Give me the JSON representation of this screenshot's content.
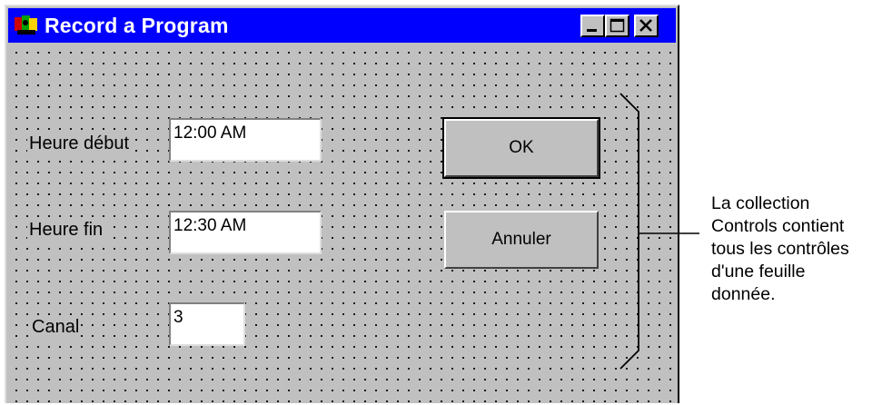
{
  "window": {
    "title": "Record a Program",
    "controls": {
      "minimize_icon": "minimize-icon",
      "maximize_icon": "maximize-icon",
      "close_icon": "close-icon"
    }
  },
  "form": {
    "fields": [
      {
        "label": "Heure début",
        "value": "12:00 AM"
      },
      {
        "label": "Heure fin",
        "value": "12:30 AM"
      },
      {
        "label": "Canal",
        "value": "3"
      }
    ],
    "buttons": {
      "ok": "OK",
      "cancel": "Annuler"
    }
  },
  "annotation": {
    "lines": [
      "La collection",
      "Controls contient",
      "tous les contrôles",
      "d'une feuille",
      "donnée."
    ]
  },
  "colors": {
    "titlebar": "#0000ff",
    "face": "#c0c0c0"
  }
}
